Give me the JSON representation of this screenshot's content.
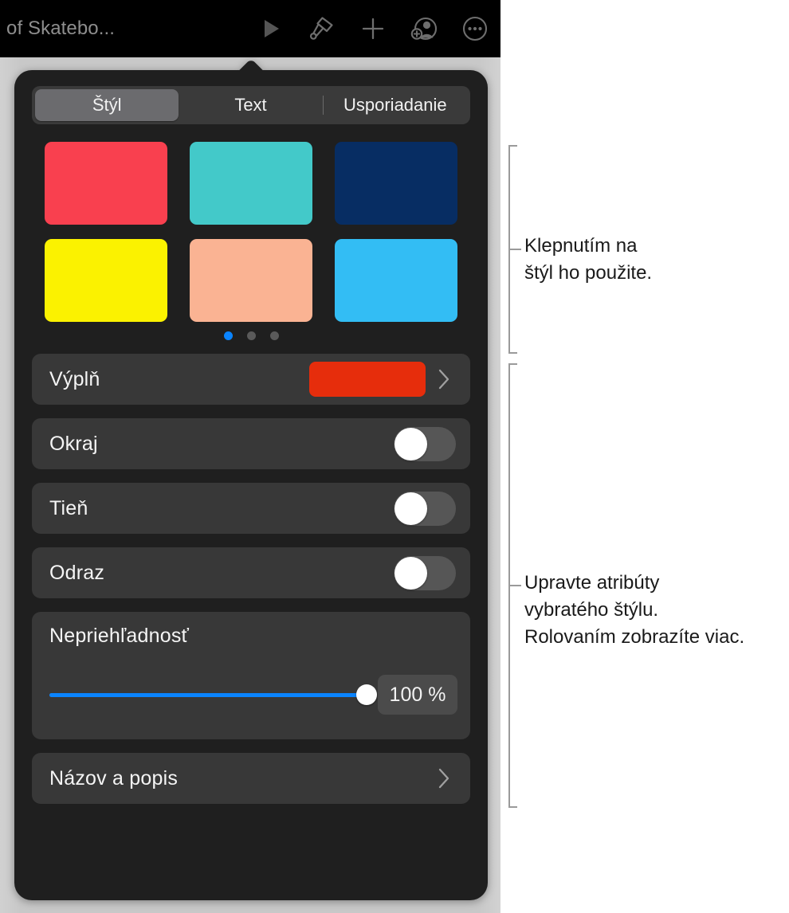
{
  "toolbar": {
    "doc_title": "of Skatebo...",
    "buttons": [
      {
        "name": "play-icon",
        "label": "Prehrať"
      },
      {
        "name": "format-brush-icon",
        "label": "Formát"
      },
      {
        "name": "plus-icon",
        "label": "Pridať"
      },
      {
        "name": "add-person-icon",
        "label": "Spolupráca"
      },
      {
        "name": "more-ellipsis-icon",
        "label": "Viac"
      }
    ]
  },
  "panel": {
    "tabs": [
      {
        "label": "Štýl",
        "active": true
      },
      {
        "label": "Text",
        "active": false
      },
      {
        "label": "Usporiadanie",
        "active": false
      }
    ],
    "styles": {
      "swatches": [
        {
          "name": "style-swatch-red",
          "color": "#f9404f"
        },
        {
          "name": "style-swatch-teal",
          "color": "#43c9c9"
        },
        {
          "name": "style-swatch-navy",
          "color": "#072d63"
        },
        {
          "name": "style-swatch-yellow",
          "color": "#fbf200"
        },
        {
          "name": "style-swatch-peach",
          "color": "#fab393"
        },
        {
          "name": "style-swatch-lightblue",
          "color": "#33bdf4"
        }
      ],
      "page_dots": {
        "total": 3,
        "active_index": 0,
        "active_color": "#0a84ff"
      }
    },
    "rows": {
      "fill": {
        "label": "Výplň",
        "color": "#e62d0c",
        "chevron": "›"
      },
      "border": {
        "label": "Okraj",
        "on": false
      },
      "shadow": {
        "label": "Tieň",
        "on": false
      },
      "reflection": {
        "label": "Odraz",
        "on": false
      },
      "opacity": {
        "label": "Nepriehľadnosť",
        "value": 100,
        "value_text": "100 %",
        "accent": "#0a84ff"
      },
      "title_and_description": {
        "label": "Názov a popis",
        "chevron": "›"
      }
    }
  },
  "callouts": [
    {
      "name": "callout-styles",
      "text": "Klepnutím na\nštýl ho použite."
    },
    {
      "name": "callout-attributes",
      "text": "Upravte atribúty\nvybratého štýlu.\nRolovaním zobrazíte viac."
    }
  ]
}
